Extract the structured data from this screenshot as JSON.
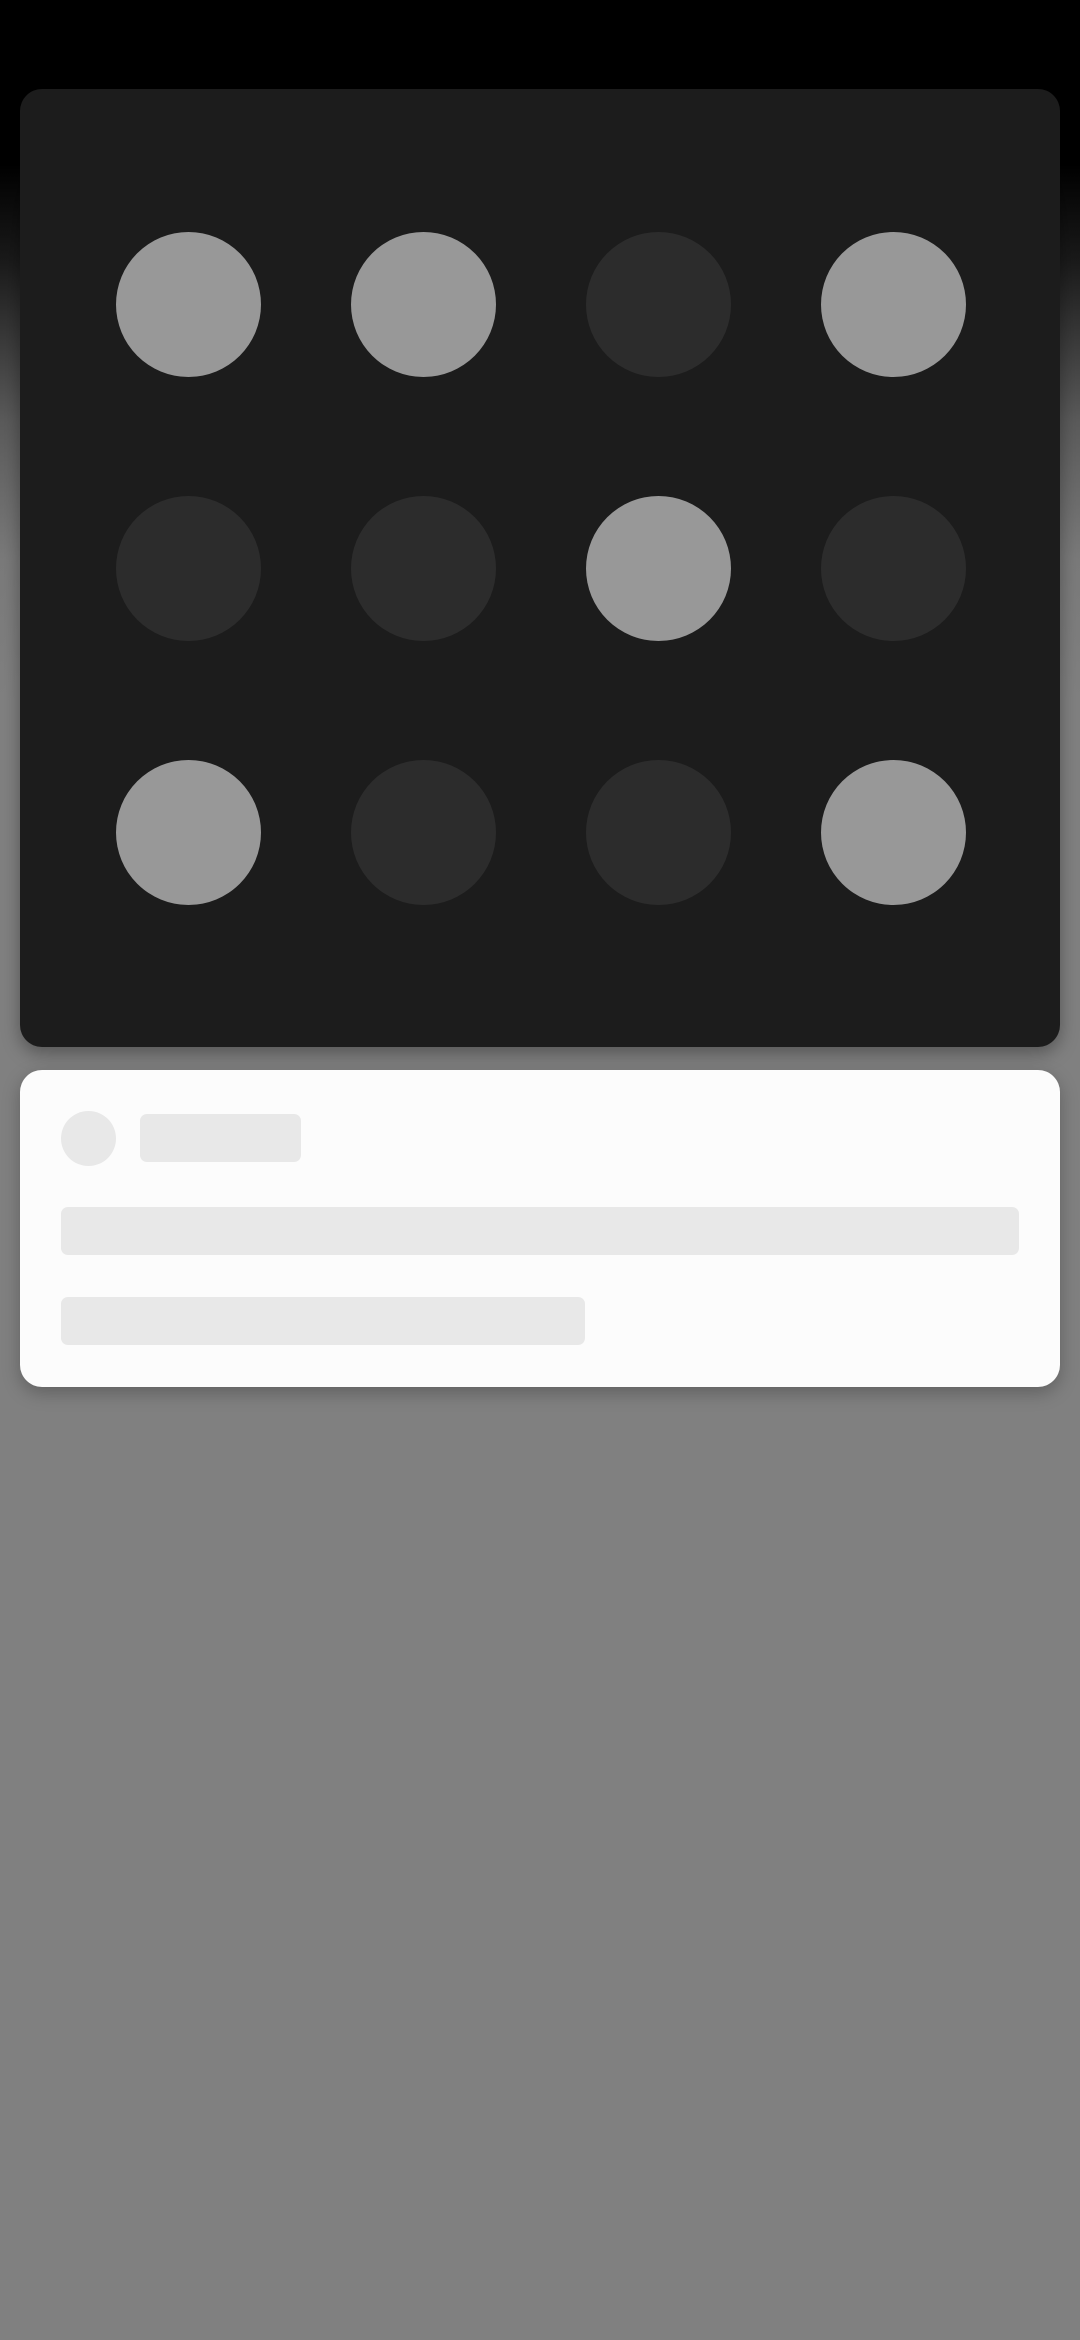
{
  "theme": {
    "card_dark": "#1c1c1c",
    "dot_active": "#989898",
    "dot_inactive": "#2c2c2c",
    "card_light": "#fcfcfc",
    "skeleton": "#e8e8e8"
  },
  "dot_grid": {
    "rows": 3,
    "cols": 4,
    "states": [
      [
        true,
        true,
        false,
        true
      ],
      [
        false,
        false,
        true,
        false
      ],
      [
        true,
        false,
        false,
        true
      ]
    ]
  },
  "info_card": {
    "loading": true
  }
}
